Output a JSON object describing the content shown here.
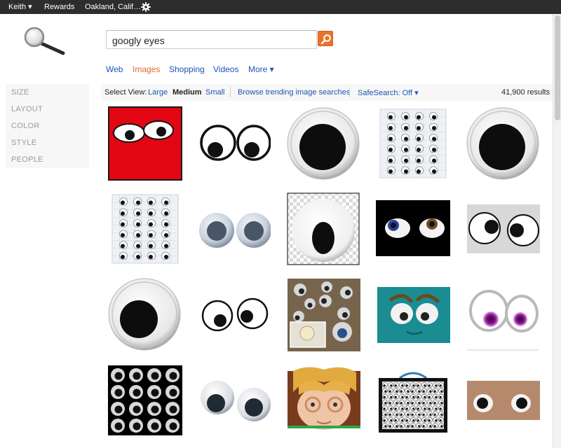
{
  "topbar": {
    "user_label": "Keith ▾",
    "rewards_label": "Rewards",
    "location_label": "Oakland, Calif…",
    "settings_icon": "gear-icon"
  },
  "search": {
    "query": "googly eyes",
    "button_icon": "search-icon"
  },
  "nav": {
    "tabs": [
      {
        "label": "Web"
      },
      {
        "label": "Images"
      },
      {
        "label": "Shopping"
      },
      {
        "label": "Videos"
      },
      {
        "label": "More ▾"
      }
    ],
    "active_tab": "Images"
  },
  "filters": [
    "SIZE",
    "LAYOUT",
    "COLOR",
    "STYLE",
    "PEOPLE"
  ],
  "options": {
    "select_view_label": "Select View:",
    "large": "Large",
    "medium": "Medium",
    "small": "Small",
    "trending": "Browse trending image searches",
    "safesearch": "SafeSearch: Off ▾",
    "results": "41,900 results"
  },
  "images": [
    {
      "desc": "red-square-eyes"
    },
    {
      "desc": "pair-eyes-looking-down"
    },
    {
      "desc": "big-single-eye"
    },
    {
      "desc": "grid-card"
    },
    {
      "desc": "big-single-eye"
    },
    {
      "desc": "grid-card"
    },
    {
      "desc": "pair-blue-eyes"
    },
    {
      "desc": "single-eye-oval-pupil"
    },
    {
      "desc": "pair-eyes-on-black"
    },
    {
      "desc": "pair-eyes-on-gray"
    },
    {
      "desc": "big-single-eye"
    },
    {
      "desc": "pair-eyes-small"
    },
    {
      "desc": "photo-collage"
    },
    {
      "desc": "teal-face"
    },
    {
      "desc": "purple-eyes"
    },
    {
      "desc": "black-grid"
    },
    {
      "desc": "pair-dark-eyes"
    },
    {
      "desc": "child-photo"
    },
    {
      "desc": "purse-with-eyes"
    },
    {
      "desc": "pair-eyes-brown"
    }
  ],
  "colors": {
    "topbar_bg": "#2d2d2d",
    "link": "#1a55b5",
    "active": "#dd6b28",
    "search_button": "#e8742b"
  }
}
